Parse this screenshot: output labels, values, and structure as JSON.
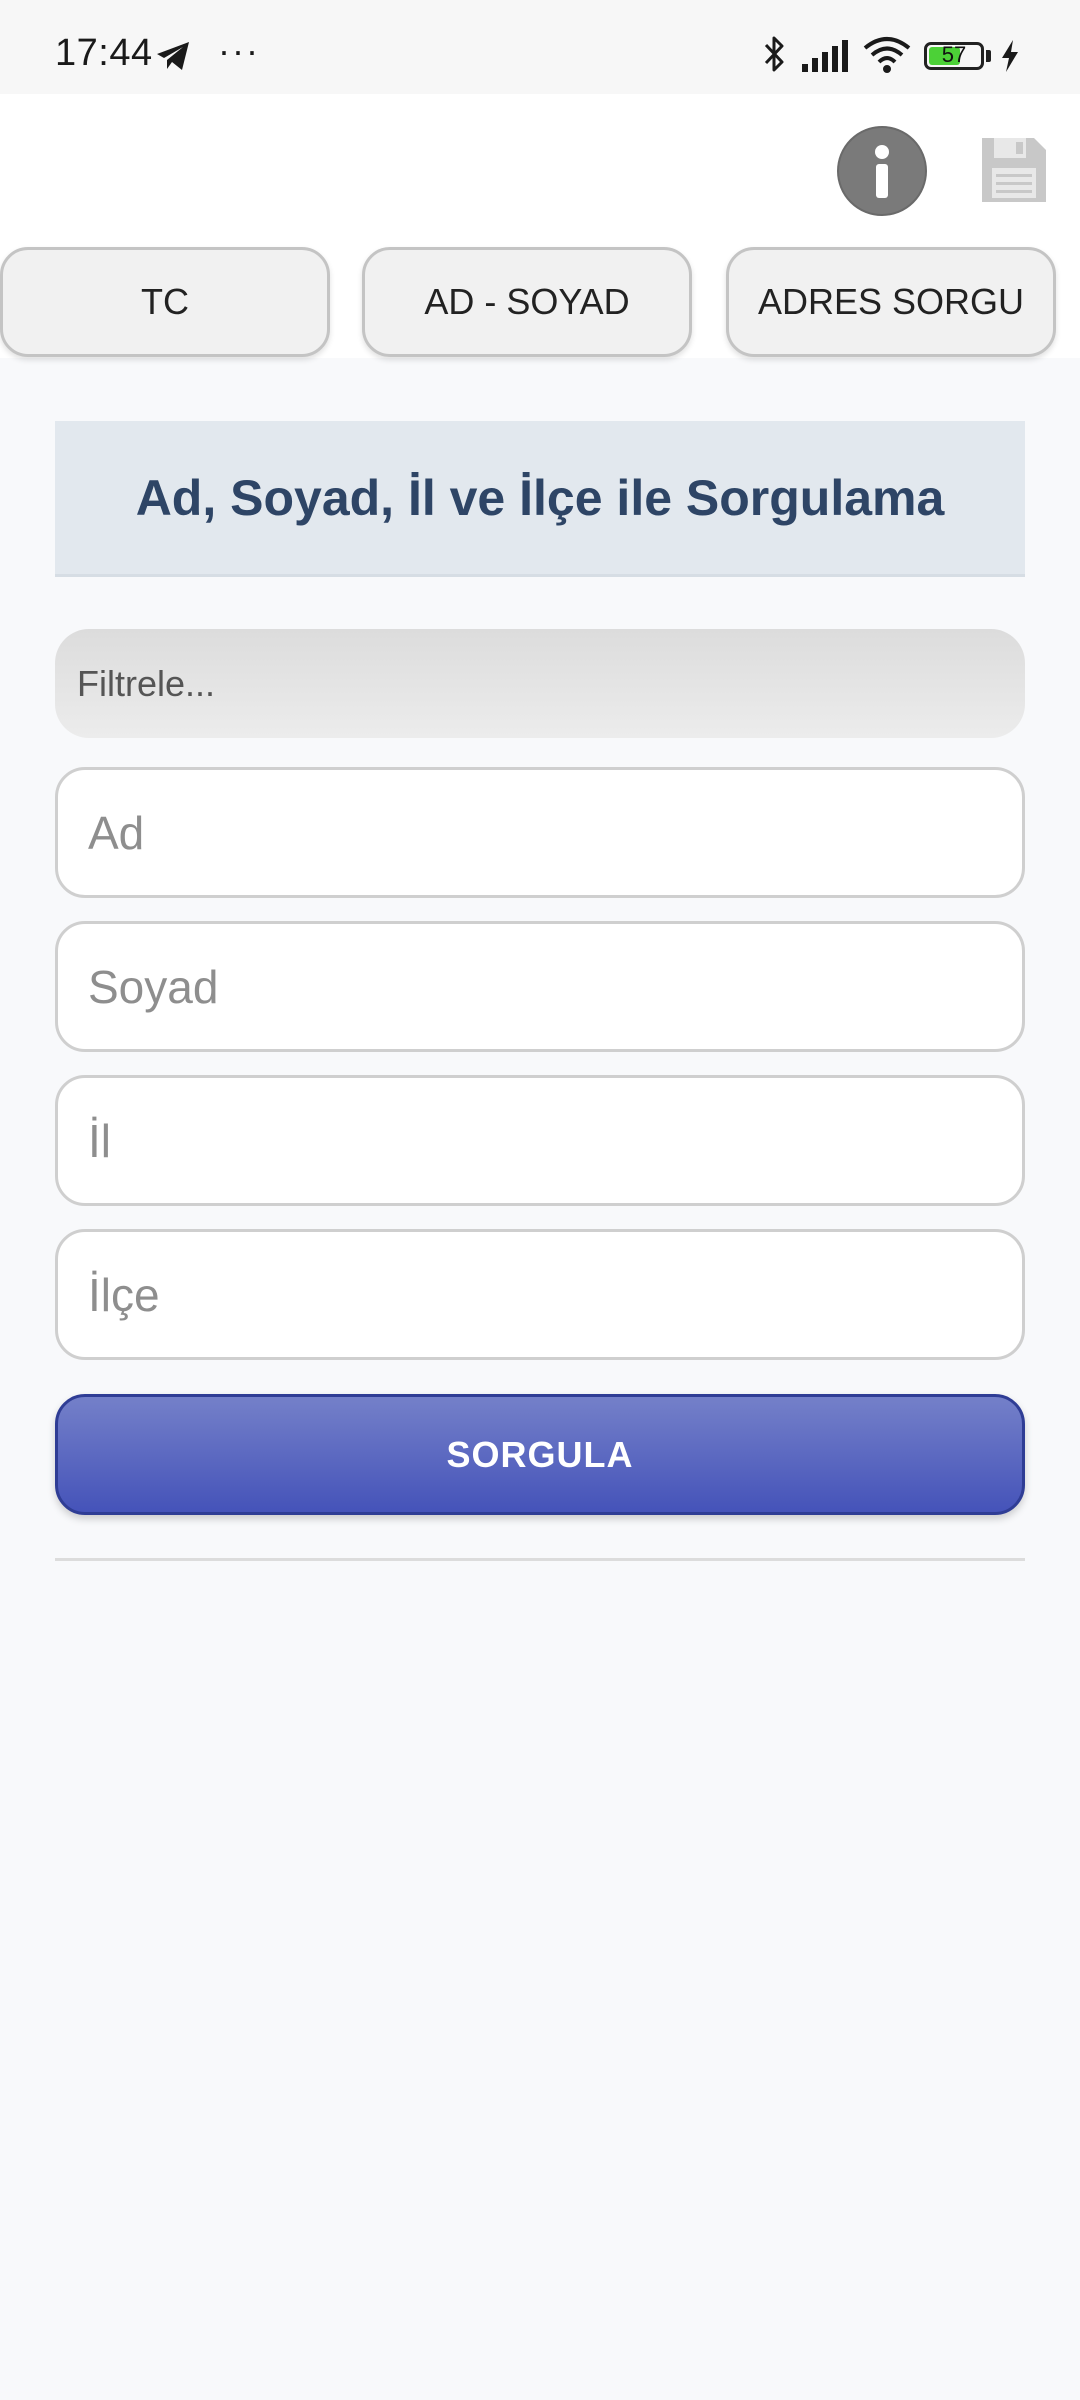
{
  "status_bar": {
    "time": "17:44",
    "more": "···",
    "battery_level": "57",
    "battery_color": "#4cd137"
  },
  "header": {
    "info_icon": "info-icon",
    "save_icon": "floppy-disk-icon"
  },
  "tabs": [
    {
      "label": "TC"
    },
    {
      "label": "AD - SOYAD"
    },
    {
      "label": "ADRES SORGU"
    }
  ],
  "main": {
    "title": "Ad, Soyad, İl ve İlçe ile Sorgulama",
    "filter_placeholder": "Filtrele...",
    "fields": [
      {
        "placeholder": "Ad"
      },
      {
        "placeholder": "Soyad"
      },
      {
        "placeholder": "İl"
      },
      {
        "placeholder": "İlçe"
      }
    ],
    "submit_label": "SORGULA"
  },
  "colors": {
    "title_text": "#2e4566",
    "title_bg": "#e2e8ee",
    "button_top": "#7480c9",
    "button_bottom": "#4553b9"
  }
}
